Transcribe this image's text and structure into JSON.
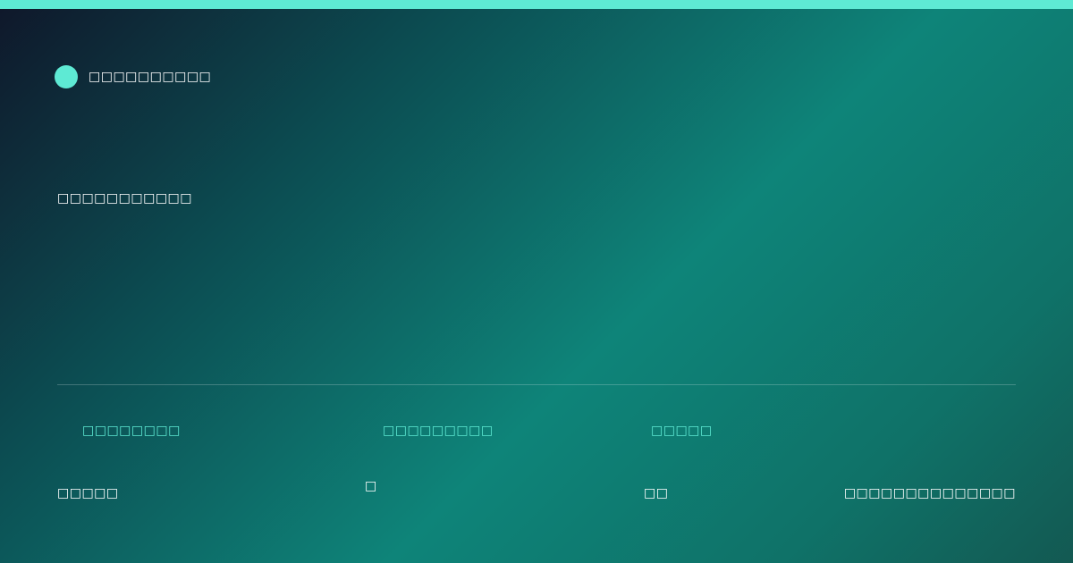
{
  "colors": {
    "accent": "#5eead4",
    "background_start": "#0f172a",
    "background_mid": "#0e8479",
    "text": "#ffffff"
  },
  "brand": {
    "logo_icon": "circle-dot",
    "name": "□□□□□□□□□□"
  },
  "headline": "□□□□□□□□□□□",
  "stats": [
    {
      "label": "□□□□□□□□",
      "value": "□□□□□"
    },
    {
      "label": "□□□□□□□□□",
      "value": "□"
    },
    {
      "label": "□□□□□",
      "value": "□□"
    }
  ],
  "footer_text": "□□□□□□□□□□□□□□"
}
